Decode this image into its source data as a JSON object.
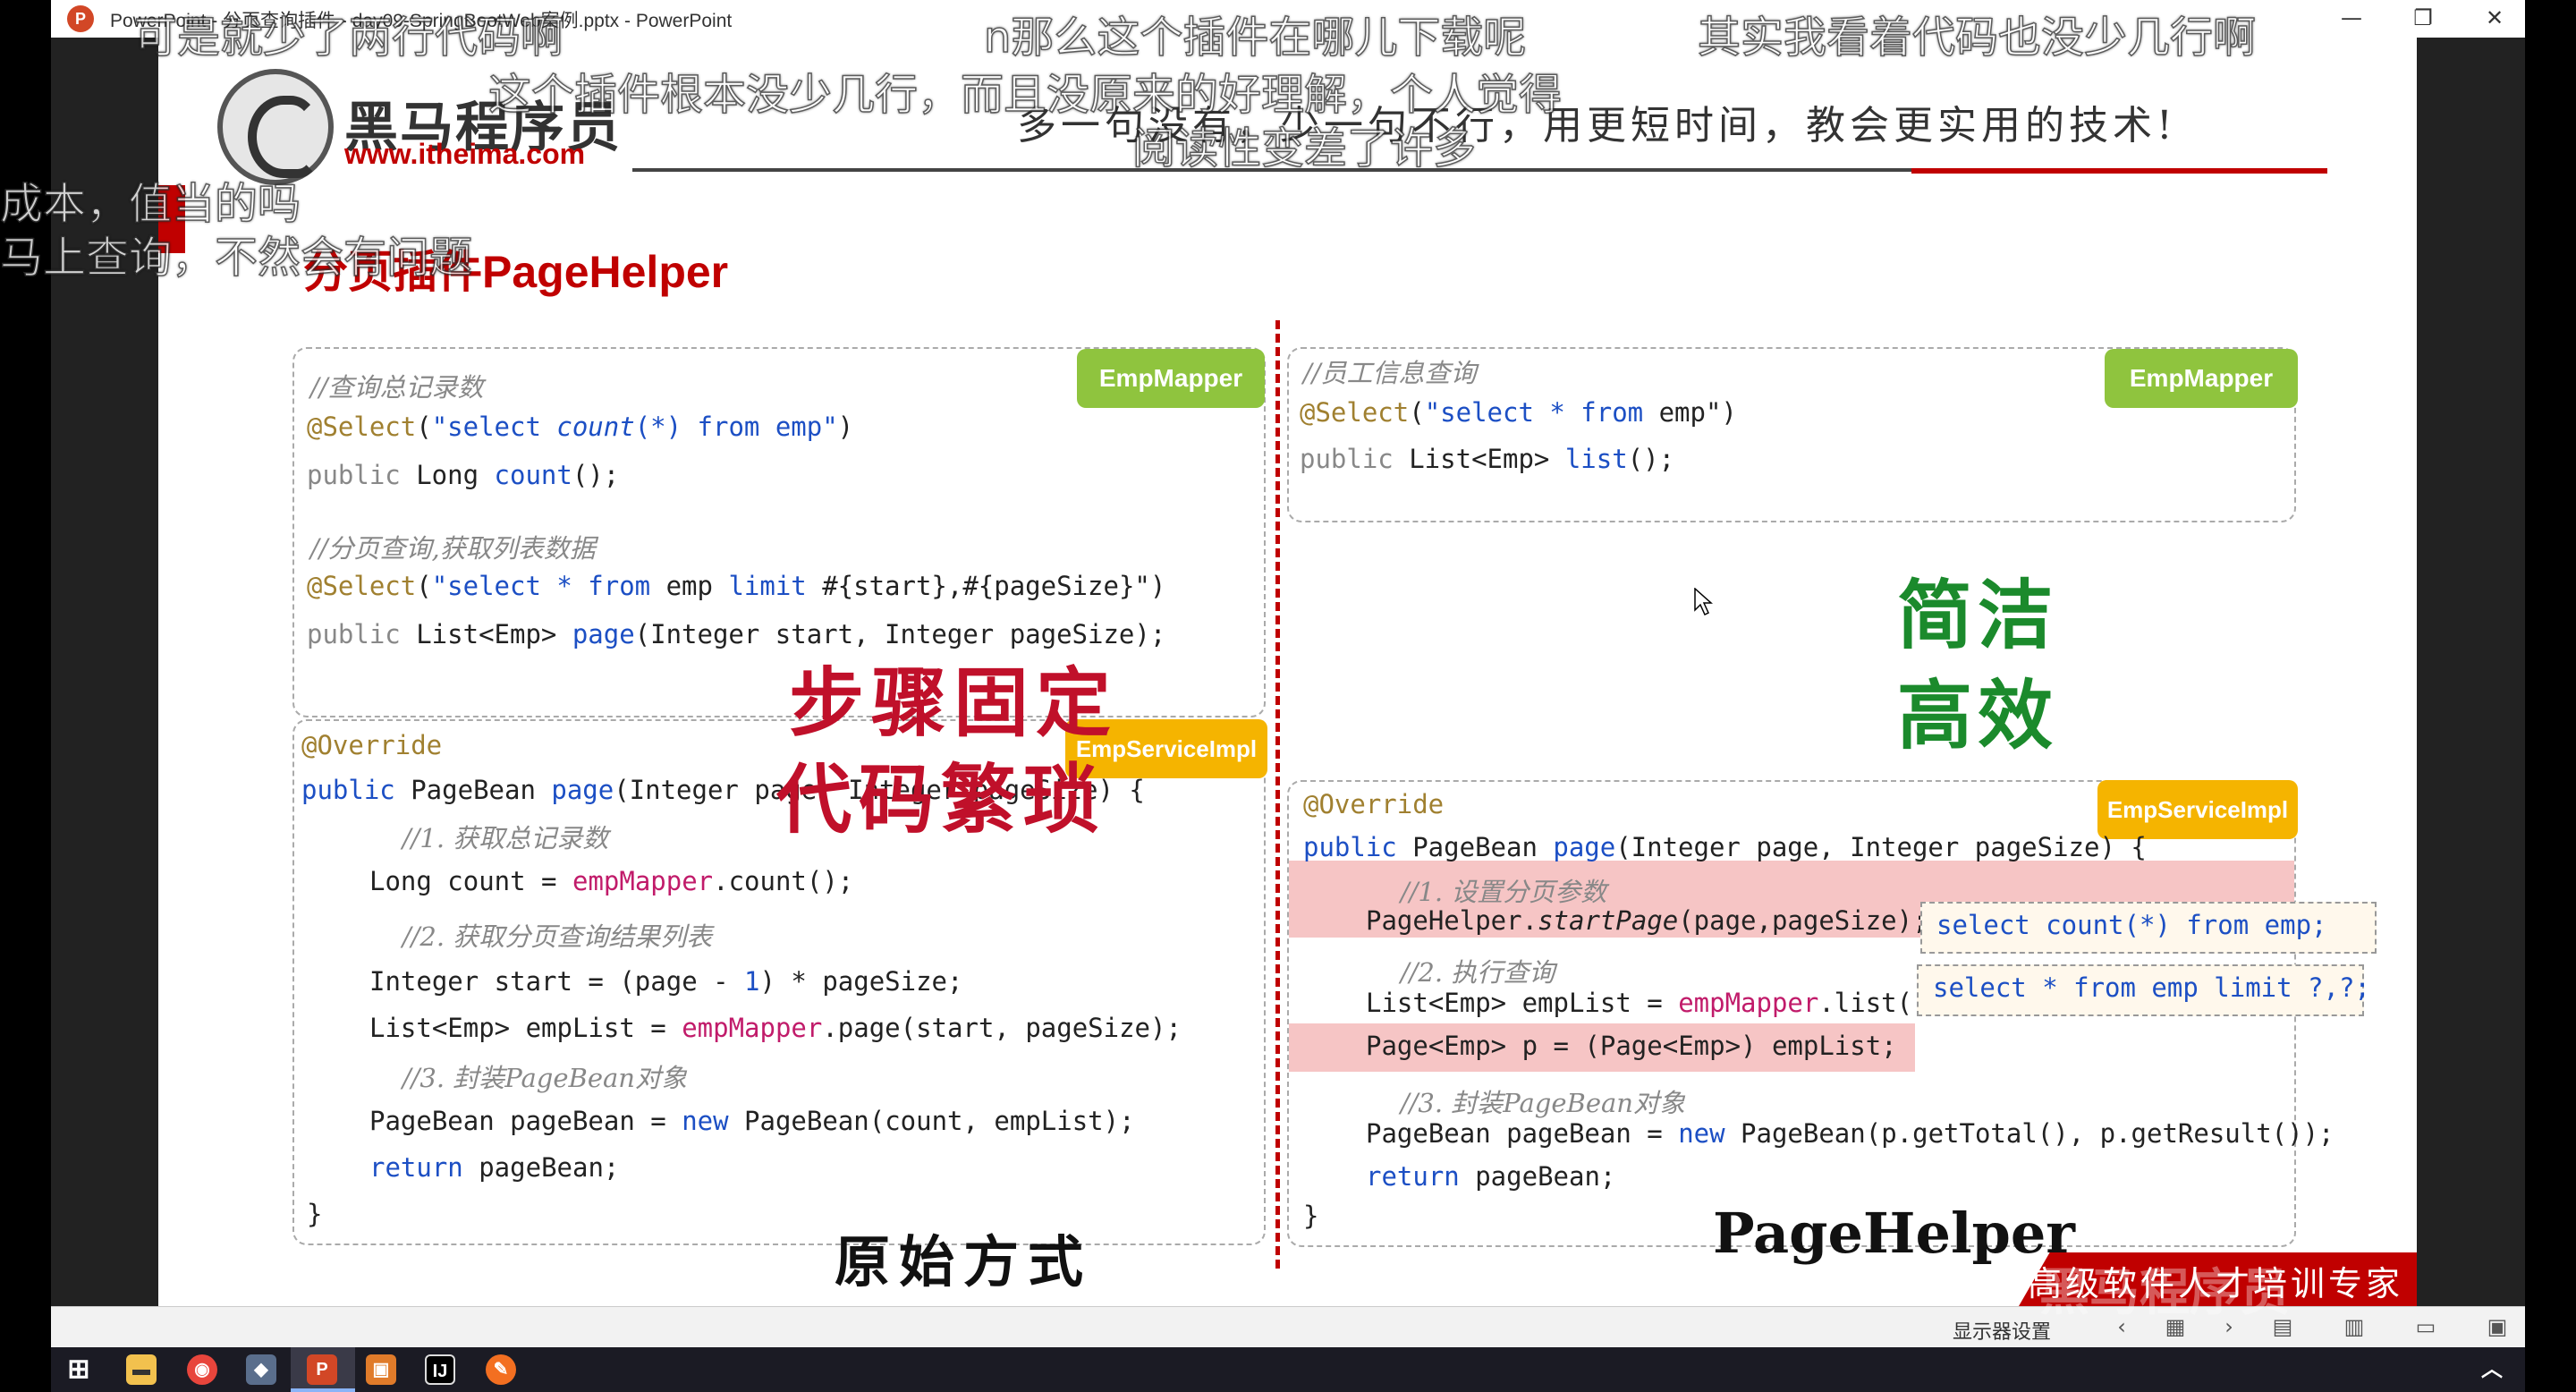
{
  "window": {
    "app_icon_letter": "P",
    "title": "PowerPoint - 分页查询插件 - day09-SpringBootWeb案例.pptx - PowerPoint",
    "minimize": "—",
    "maximize": "❐",
    "close": "✕"
  },
  "slide": {
    "brand_name": "黑马程序员",
    "brand_url": "www.itheima.com",
    "slogan": "多一句没有，少一句不行，用更短时间，教会更实用的技术!",
    "title": "分页插件PageHelper",
    "left": {
      "mapper_tag": "EmpMapper",
      "service_tag": "EmpServiceImpl",
      "mapper_lines": [
        "//查询总记录数",
        "@Select(\"select count(*) from emp\")",
        "public Long count();",
        "//分页查询,获取列表数据",
        "@Select(\"select * from emp limit #{start},#{pageSize}\")",
        "public List<Emp> page(Integer start, Integer pageSize);"
      ],
      "service_lines": [
        "@Override",
        "public PageBean page(Integer page, Integer pageSize) {",
        "    //1. 获取总记录数",
        "    Long count = empMapper.count();",
        "    //2. 获取分页查询结果列表",
        "    Integer start = (page - 1) * pageSize;",
        "    List<Emp> empList = empMapper.page(start, pageSize);",
        "    //3. 封装PageBean对象",
        "    PageBean pageBean = new PageBean(count, empList);",
        "    return pageBean;",
        "}"
      ],
      "callout_line1": "步骤固定",
      "callout_line2": "代码繁琐",
      "caption": "原始方式"
    },
    "right": {
      "mapper_tag": "EmpMapper",
      "service_tag": "EmpServiceImpl",
      "mapper_lines": [
        "//员工信息查询",
        "@Select(\"select * from emp\")",
        "public List<Emp> list();"
      ],
      "service_lines": [
        "@Override",
        "public PageBean page(Integer page, Integer pageSize) {",
        "    //1. 设置分页参数",
        "    PageHelper.startPage(page,pageSize);",
        "    //2. 执行查询",
        "    List<Emp> empList = empMapper.list();",
        "    Page<Emp> p = (Page<Emp>) empList;",
        "    //3. 封装PageBean对象",
        "    PageBean pageBean = new PageBean(p.getTotal(), p.getResult());",
        "    return pageBean;",
        "}"
      ],
      "sql_count": "select count(*) from emp;",
      "sql_limit": "select * from emp limit ?,?;",
      "callout_line1": "简洁",
      "callout_line2": "高效",
      "caption": "PageHelper"
    },
    "footer_banner": "高级软件人才培训专家"
  },
  "statusbar": {
    "display_settings": "显示器设置"
  },
  "taskbar": {
    "items": [
      "start",
      "file-explorer",
      "chrome",
      "app",
      "powerpoint",
      "app2",
      "intellij",
      "app3"
    ]
  },
  "danmaku": [
    "可是就少了两行代码啊",
    "n那么这个插件在哪儿下载呢",
    "其实我看着代码也没少几行啊",
    "这个插件根本没少几行，而且没原来的好理解，个人觉得",
    "阅读性变差了许多",
    "成本，值当的吗",
    "马上查询，不然会有问题"
  ],
  "watermark": "黑马程序员",
  "colors": {
    "accent_red": "#c00000",
    "tag_green": "#8fc43e",
    "tag_yellow": "#f5b400",
    "highlight_pink": "#f6c5c5",
    "callout_green": "#1b8a2c"
  }
}
